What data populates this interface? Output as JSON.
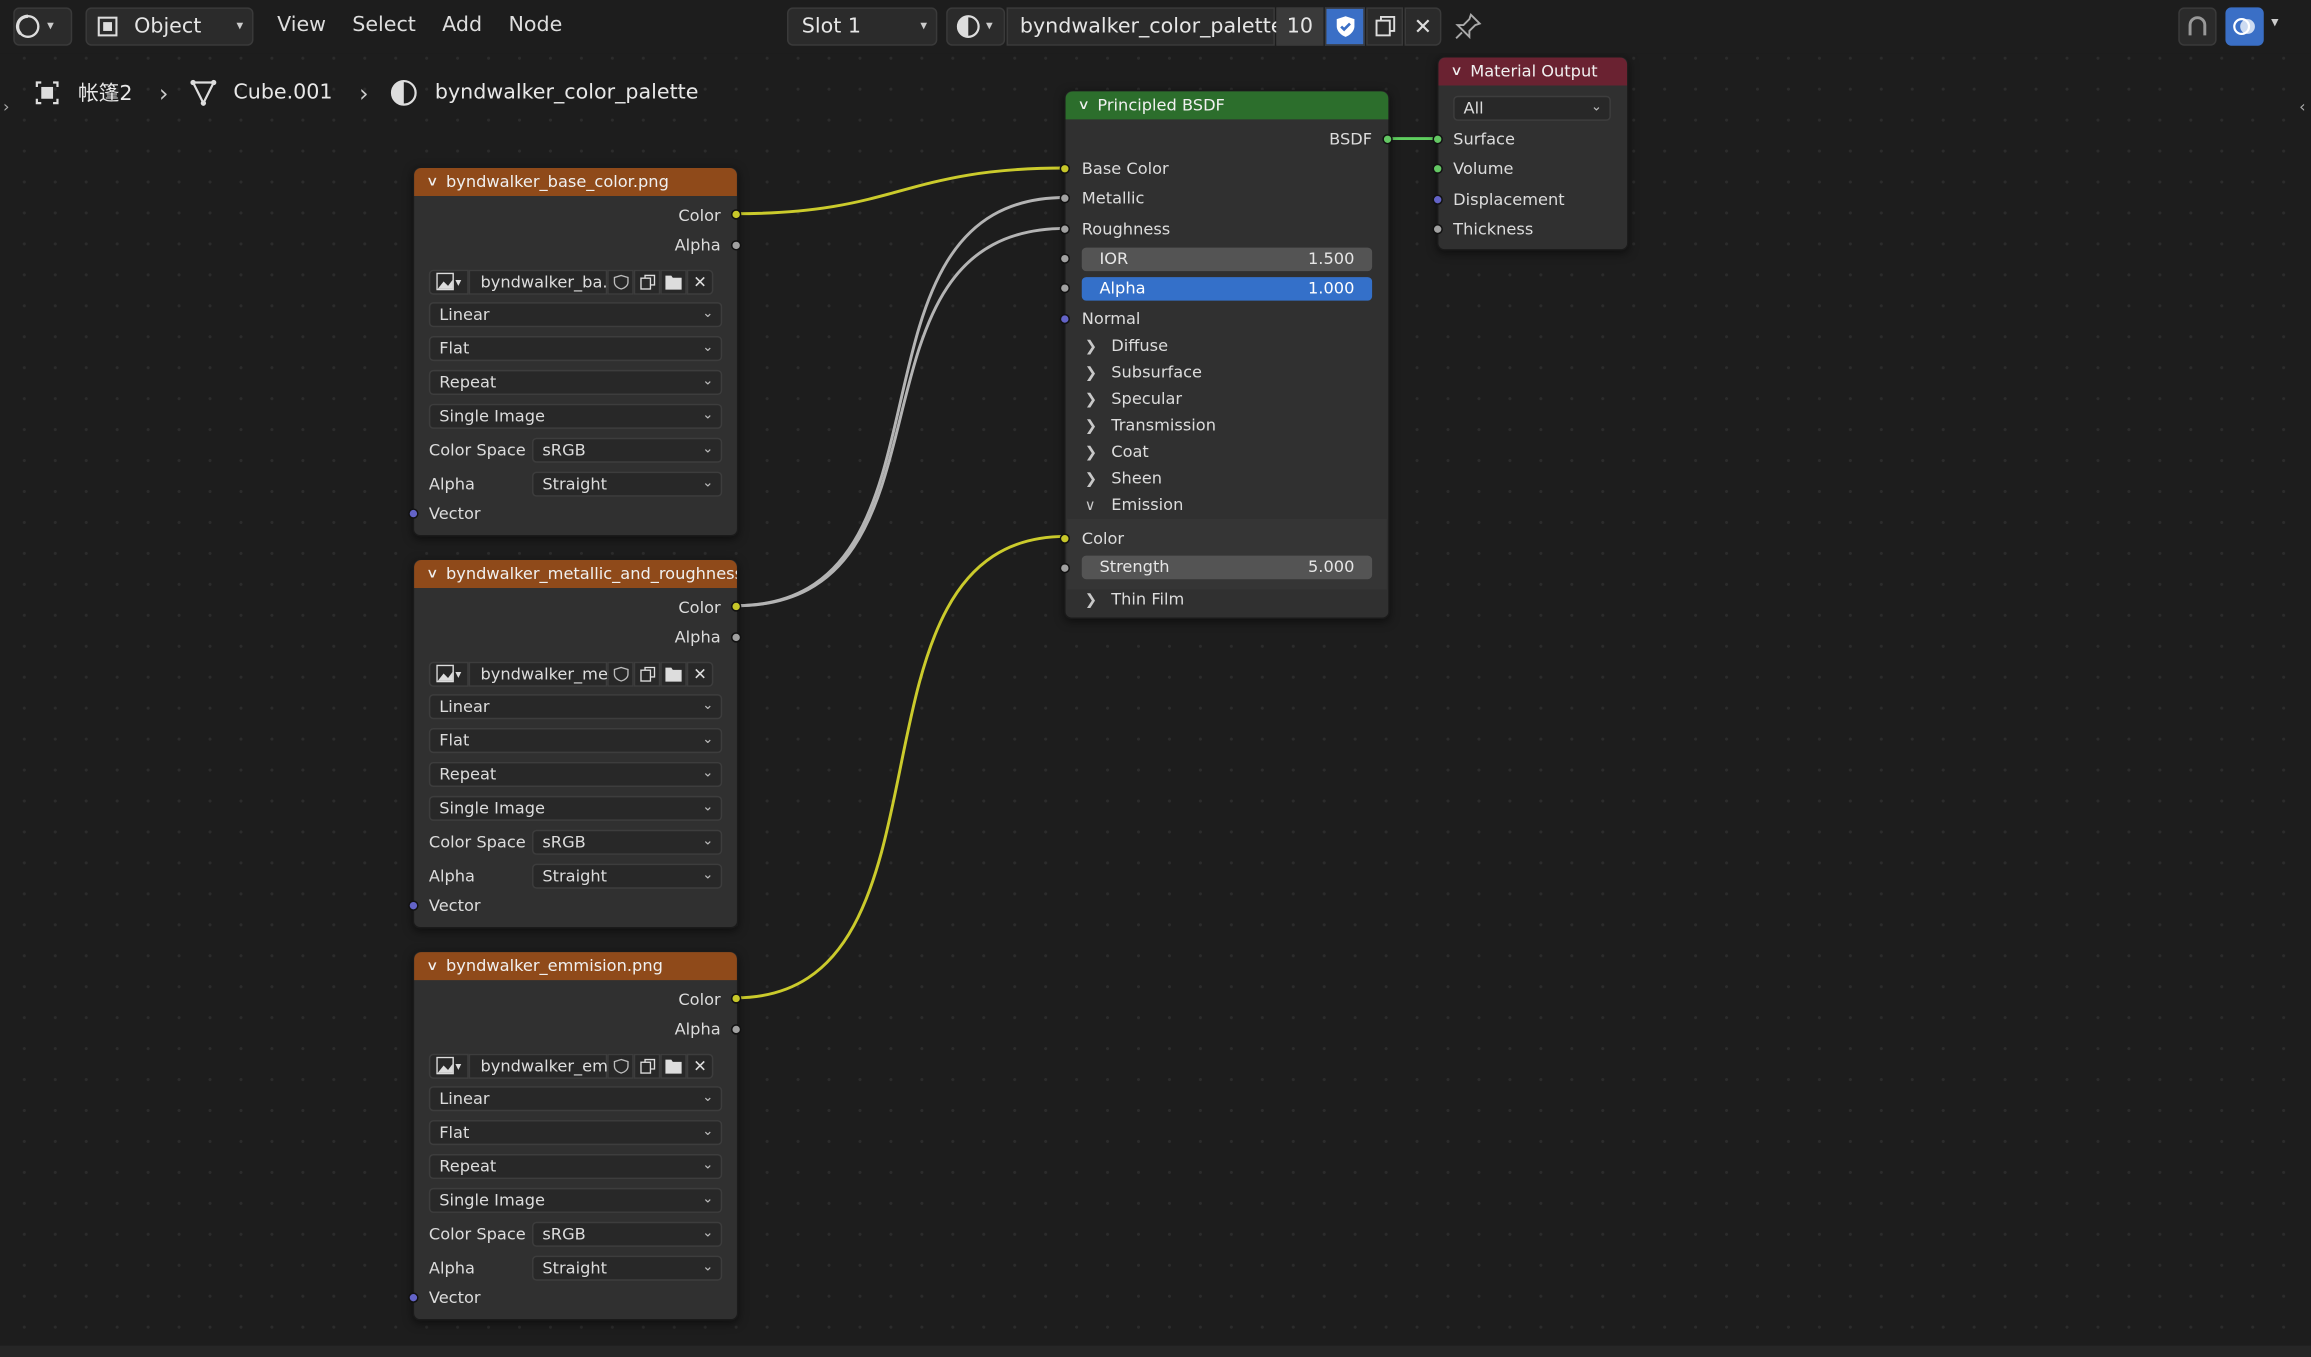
{
  "header": {
    "mode": "Object",
    "menus": [
      "View",
      "Select",
      "Add",
      "Node"
    ],
    "slot": "Slot 1",
    "material_name": "byndwalker_color_palette",
    "user_count": "10"
  },
  "breadcrumb": {
    "collection": "帐篷2",
    "object": "Cube.001",
    "material": "byndwalker_color_palette"
  },
  "image_nodes": [
    {
      "title": "byndwalker_base_color.png",
      "image": "byndwalker_ba...",
      "interpolation": "Linear",
      "projection": "Flat",
      "extension": "Repeat",
      "source": "Single Image",
      "color_space_label": "Color Space",
      "color_space": "sRGB",
      "alpha_label": "Alpha",
      "alpha": "Straight",
      "out_color": "Color",
      "out_alpha": "Alpha",
      "in_vector": "Vector"
    },
    {
      "title": "byndwalker_metallic_and_roughness...",
      "image": "byndwalker_me...",
      "interpolation": "Linear",
      "projection": "Flat",
      "extension": "Repeat",
      "source": "Single Image",
      "color_space_label": "Color Space",
      "color_space": "sRGB",
      "alpha_label": "Alpha",
      "alpha": "Straight",
      "out_color": "Color",
      "out_alpha": "Alpha",
      "in_vector": "Vector"
    },
    {
      "title": "byndwalker_emmision.png",
      "image": "byndwalker_em...",
      "interpolation": "Linear",
      "projection": "Flat",
      "extension": "Repeat",
      "source": "Single Image",
      "color_space_label": "Color Space",
      "color_space": "sRGB",
      "alpha_label": "Alpha",
      "alpha": "Straight",
      "out_color": "Color",
      "out_alpha": "Alpha",
      "in_vector": "Vector"
    }
  ],
  "bsdf": {
    "title": "Principled BSDF",
    "output": "BSDF",
    "base_color": "Base Color",
    "metallic": "Metallic",
    "roughness": "Roughness",
    "ior_label": "IOR",
    "ior_value": "1.500",
    "alpha_label": "Alpha",
    "alpha_value": "1.000",
    "normal": "Normal",
    "panels": [
      "Diffuse",
      "Subsurface",
      "Specular",
      "Transmission",
      "Coat",
      "Sheen"
    ],
    "emission_panel": "Emission",
    "emission_color": "Color",
    "strength_label": "Strength",
    "strength_value": "5.000",
    "thin_film": "Thin Film"
  },
  "material_output": {
    "title": "Material Output",
    "target": "All",
    "inputs": [
      "Surface",
      "Volume",
      "Displacement",
      "Thickness"
    ]
  },
  "colors": {
    "texture_header": "#8f4a1a",
    "shader_header": "#2c6e2c",
    "output_header": "#6a2231",
    "alpha_field": "#3470c9",
    "color_socket": "#c7c729",
    "float_socket": "#a1a1a1",
    "vector_socket": "#6363c7",
    "shader_socket": "#63c763"
  }
}
